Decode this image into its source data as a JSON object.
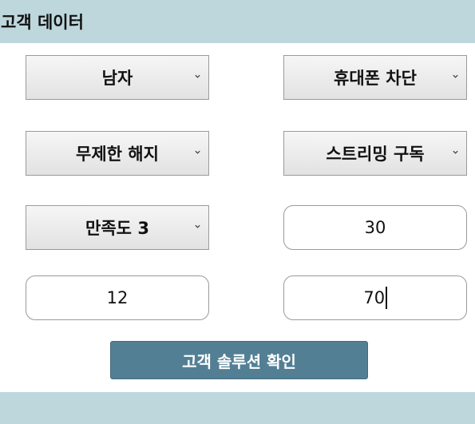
{
  "header": {
    "title": "고객 데이터"
  },
  "form": {
    "gender": "남자",
    "phone_block": "휴대폰 차단",
    "cancellation": "무제한 해지",
    "streaming": "스트리밍 구독",
    "satisfaction": "만족도 3",
    "field_right_1": "30",
    "field_left_2": "12",
    "field_right_2": "70"
  },
  "submit_label": "고객 솔루션 확인",
  "colors": {
    "header": "#bdd7dd",
    "button": "#537f94"
  },
  "icons": {
    "dropdown": "chevron-down-icon"
  }
}
